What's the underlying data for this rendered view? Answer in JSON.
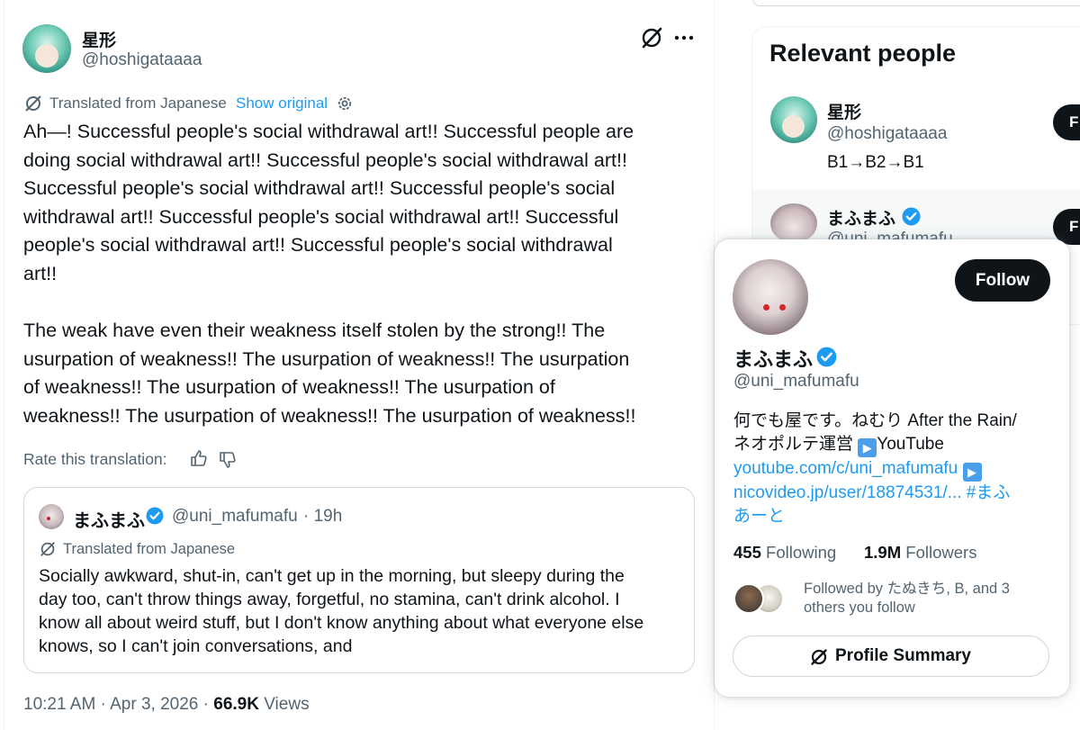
{
  "tweet": {
    "author_name": "星形",
    "author_handle": "@hoshigataaaa",
    "translated_label": "Translated from Japanese",
    "show_original": "Show original",
    "paragraph1": "Ah—! Successful people's social withdrawal art!! Successful people are\ndoing social withdrawal art!! Successful people's social withdrawal art!!\nSuccessful people's social withdrawal art!! Successful people's social\nwithdrawal art!! Successful people's social withdrawal art!! Successful\npeople's social withdrawal art!! Successful people's social withdrawal\nart!!",
    "paragraph2": "The weak have even their weakness itself stolen by the strong!! The\nusurpation of weakness!! The usurpation of weakness!! The usurpation\nof weakness!! The usurpation of weakness!! The usurpation of\nweakness!! The usurpation of weakness!! The usurpation of weakness!!",
    "rate_label": "Rate this translation:",
    "timestamp": "10:21 AM · Apr 3, 2026 · ",
    "views_count": "66.9K",
    "views_label": " Views"
  },
  "quote": {
    "author_name": "まふまふ",
    "author_handle": "@uni_mafumafu",
    "time": " · 19h",
    "translated_label": "Translated from Japanese",
    "text": "Socially awkward, shut-in, can't get up in the morning, but sleepy during the\nday too, can't throw things away, forgetful, no stamina, can't drink alcohol. I\nknow all about weird stuff, but I don't know anything about what everyone else\nknows, so I can't join conversations, and"
  },
  "relevant_people": {
    "title": "Relevant people",
    "people": [
      {
        "name": "星形",
        "handle": "@hoshigataaaa",
        "bio": "B1→B2→B1",
        "follow_label": "F"
      },
      {
        "name": "まふまふ",
        "handle": "@uni_mafumafu",
        "follow_label": "F"
      }
    ]
  },
  "hover_card": {
    "follow_label": "Follow",
    "name": "まふまふ",
    "handle": "@uni_mafumafu",
    "bio_line1": "何でも屋です。ねむり After the Rain/",
    "bio_line2": "ネオポルテ運営 ",
    "play_emoji": "▶",
    "bio_youtube": "YouTube",
    "link1": "youtube.com/c/uni_mafumafu",
    "link2": "nicovideo.jp/user/18874531/...",
    "hashtag_part1": "#まふ",
    "hashtag_part2": "あーと",
    "following_count": "455",
    "following_label": "Following",
    "followers_count": "1.9M",
    "followers_label": "Followers",
    "followed_by_line1": "Followed by たぬきち, B, and 3",
    "followed_by_line2": "others you follow",
    "profile_summary_label": "Profile Summary"
  },
  "colors": {
    "accent": "#1d9bf0",
    "text": "#0f1419",
    "secondary": "#536471",
    "border": "#cfd9de",
    "verified": "#1d9bf0"
  },
  "icons": [
    "grok-icon",
    "more-icon",
    "translate-icon",
    "gear-icon",
    "thumbs-up-icon",
    "thumbs-down-icon",
    "verified-badge-icon"
  ]
}
